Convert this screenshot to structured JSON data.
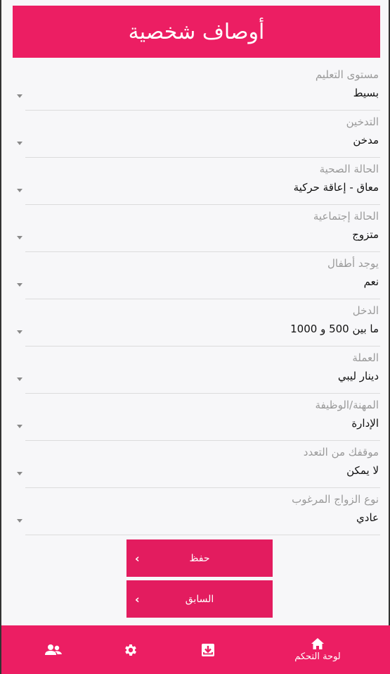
{
  "header": {
    "title": "أوصاف شخصية"
  },
  "fields": [
    {
      "label": "مستوى التعليم",
      "value": "بسيط"
    },
    {
      "label": "التدخين",
      "value": "مدخن"
    },
    {
      "label": "الحالة الصحية",
      "value": "معاق - إعاقة حركية"
    },
    {
      "label": "الحالة إجتماعية",
      "value": "متزوج"
    },
    {
      "label": "يوجد أطفال",
      "value": "نعم"
    },
    {
      "label": "الدخل",
      "value": "ما بين 500 و 1000"
    },
    {
      "label": "العملة",
      "value": "دينار ليبي"
    },
    {
      "label": "المهنة/الوظيفة",
      "value": "الإدارة"
    },
    {
      "label": "موقفك من التعدد",
      "value": "لا يمكن"
    },
    {
      "label": "نوع الزواج المرغوب",
      "value": "عادي"
    }
  ],
  "buttons": {
    "save_label": "حفظ",
    "prev_label": "السابق"
  },
  "bottom_nav": {
    "dashboard_label": "لوحة التحكم",
    "icons": [
      "users-icon",
      "gear-icon",
      "download-box-icon",
      "home-icon"
    ]
  },
  "colors": {
    "accent": "#ec1e63",
    "button": "#e31c5f"
  }
}
